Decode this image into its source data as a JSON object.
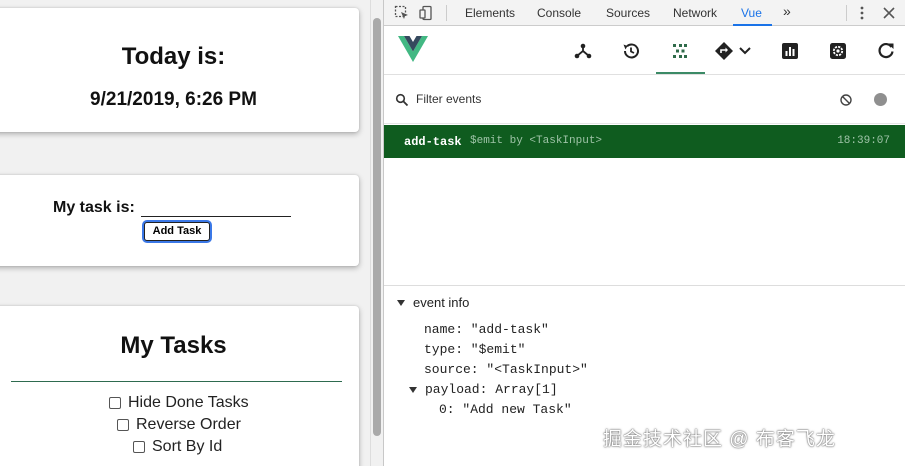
{
  "app": {
    "today_title": "Today is:",
    "today_date": "9/21/2019, 6:26 PM",
    "task_label": "My task is:",
    "task_input_value": "",
    "add_task_label": "Add Task",
    "list_title": "My Tasks",
    "options": [
      {
        "label": "Hide Done Tasks",
        "checked": false
      },
      {
        "label": "Reverse Order",
        "checked": false
      },
      {
        "label": "Sort By Id",
        "checked": false
      }
    ]
  },
  "devtools": {
    "tabs": [
      "Elements",
      "Console",
      "Sources",
      "Network",
      "Vue"
    ],
    "active_tab": "Vue",
    "more_label": "»",
    "vue_tools": [
      "components-icon",
      "history-icon",
      "events-icon",
      "routing-icon",
      "performance-icon",
      "settings-icon",
      "refresh-icon"
    ],
    "active_tool": "events-icon",
    "filter_placeholder": "Filter events",
    "event": {
      "name": "add-task",
      "by": "$emit by <TaskInput>",
      "time": "18:39:07"
    },
    "info": {
      "heading": "event info",
      "name_line": "name: \"add-task\"",
      "type_line": "type: \"$emit\"",
      "source_line": "source: \"<TaskInput>\"",
      "payload_line": "payload: Array[1]",
      "payload_item": "0: \"Add new Task\""
    },
    "accent_color": "#0f5c1f",
    "vue_green": "#42b883"
  },
  "watermark": "掘金技术社区 @ 布客飞龙"
}
